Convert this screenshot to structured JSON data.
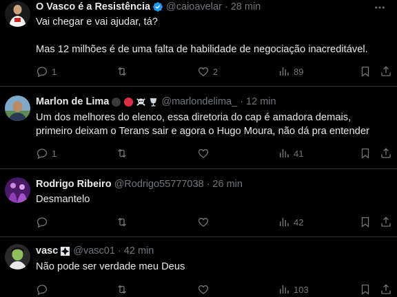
{
  "tweets": [
    {
      "name": "O Vasco é a Resistência",
      "verified": true,
      "handle": "@caioavelar",
      "time": "28 min",
      "text": "Vai chegar e vai ajudar, tá?\n\nMas 12 milhões é de uma falta de habilidade de negociação inacreditável.",
      "replies": "1",
      "retweets": "",
      "likes": "2",
      "views": "89"
    },
    {
      "name": "Marlon de Lima",
      "name_emojis": [
        "black-circle",
        "red-circle",
        "skull-crossbones",
        "goblet"
      ],
      "handle": "@marlondelima_",
      "time": "12 min",
      "text": "Um dos melhores do elenco, essa diretoria do cap é amadora demais,\nprimeiro deixam o Terans sair e agora o Hugo Moura, não dá pra entender",
      "replies": "1",
      "retweets": "",
      "likes": "",
      "views": "41"
    },
    {
      "name": "Rodrigo Ribeiro",
      "handle": "@Rodrigo55777038",
      "time": "26 min",
      "text": "Desmantelo",
      "replies": "",
      "retweets": "",
      "likes": "",
      "views": "42"
    },
    {
      "name": "vasc",
      "name_emojis": [
        "vasco-cross"
      ],
      "handle": "@vasc01",
      "time": "42 min",
      "text": "Não pode ser verdade meu Deus",
      "replies": "",
      "retweets": "",
      "likes": "",
      "views": "103"
    }
  ],
  "separator": "·",
  "colors": {
    "background": "#000000",
    "text": "#e7e9ea",
    "muted": "#71767b",
    "divider": "#2f3336",
    "verified": "#1d9bf0"
  }
}
